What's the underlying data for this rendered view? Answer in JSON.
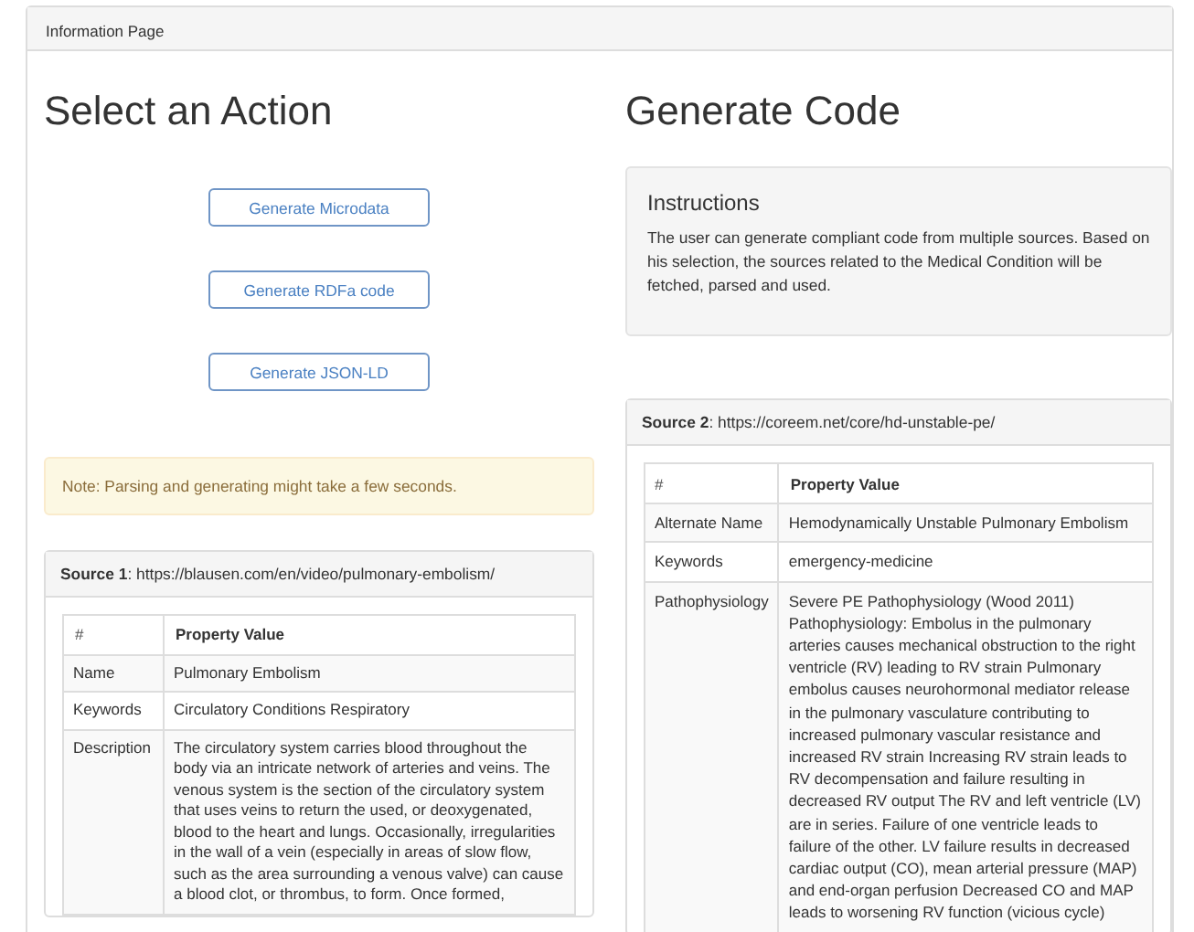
{
  "panel_title": "Information Page",
  "left": {
    "heading": "Select an Action",
    "buttons": [
      "Generate Microdata",
      "Generate RDFa code",
      "Generate JSON-LD"
    ],
    "note": "Note: Parsing and generating might take a few seconds.",
    "source": {
      "title": "**Source 1**: https://blausen.com/en/video/pulmonary-embolism/",
      "columns": [
        "#",
        "Property Value"
      ],
      "rows": [
        {
          "property": "Name",
          "value": "Pulmonary Embolism"
        },
        {
          "property": "Keywords",
          "value": "Circulatory Conditions Respiratory"
        },
        {
          "property": "Description",
          "value": "The circulatory system carries blood throughout the body via an intricate network of arteries and veins. The venous system is the section of the circulatory system that uses veins to return the used, or deoxygenated, blood to the heart and lungs. Occasionally, irregularities in the wall of a vein (especially in areas of slow flow, such as the area surrounding a venous valve) can cause a blood clot, or thrombus, to form. Once formed,"
        }
      ]
    }
  },
  "right": {
    "heading": "Generate Code",
    "instructions": {
      "title": "Instructions",
      "text": "The user can generate compliant code from multiple sources. Based on his selection, the sources related to the Medical Condition will be fetched, parsed and used."
    },
    "source": {
      "title": "**Source 2**: https://coreem.net/core/hd-unstable-pe/",
      "columns": [
        "#",
        "Property Value"
      ],
      "rows": [
        {
          "property": "Alternate Name",
          "value": "Hemodynamically Unstable Pulmonary Embolism"
        },
        {
          "property": "Keywords",
          "value": "emergency-medicine"
        },
        {
          "property": "Pathophysiology",
          "value": "Severe PE Pathophysiology (Wood 2011) Pathophysiology: Embolus in the pulmonary arteries causes mechanical obstruction to the right ventricle (RV) leading to RV strain Pulmonary embolus causes neurohormonal mediator release in the pulmonary vasculature contributing to increased pulmonary vascular resistance and increased RV strain Increasing RV strain leads to RV decompensation and failure resulting in decreased RV output The RV and left ventricle (LV) are in series. Failure of one ventricle leads to failure of the other. LV failure results in decreased cardiac output (CO), mean arterial pressure (MAP) and end-organ perfusion Decreased CO and MAP leads to worsening RV function (vicious cycle)"
        }
      ]
    }
  }
}
